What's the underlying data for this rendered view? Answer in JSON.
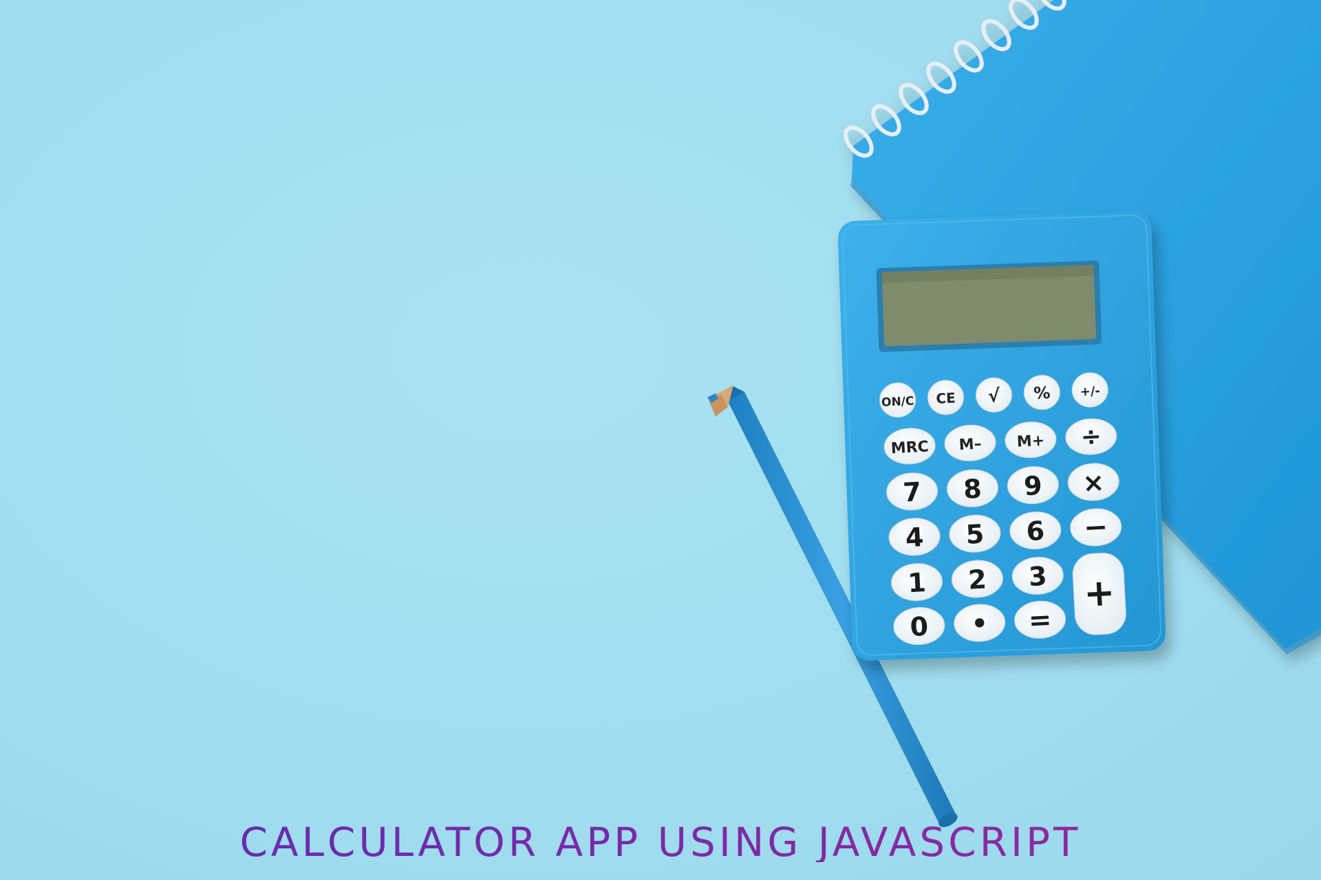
{
  "headline": "CALCULATOR APP USING JAVASCRIPT",
  "colors": {
    "background": "#a3dff0",
    "calculator_body": "#2fa4e0",
    "notebook": "#2ba3e3",
    "pencil": "#2a8fd0",
    "display": "#7f8b6c",
    "headline_start": "#5a2fb0",
    "headline_end": "#9a2a98"
  },
  "calculator": {
    "rows": [
      [
        "ON/C",
        "CE",
        "√",
        "%",
        "+/-"
      ],
      [
        "MRC",
        "M–",
        "M+",
        "÷"
      ],
      [
        "7",
        "8",
        "9",
        "×"
      ],
      [
        "4",
        "5",
        "6",
        "−"
      ],
      [
        "1",
        "2",
        "3",
        "+"
      ],
      [
        "0",
        "•",
        "="
      ]
    ]
  }
}
